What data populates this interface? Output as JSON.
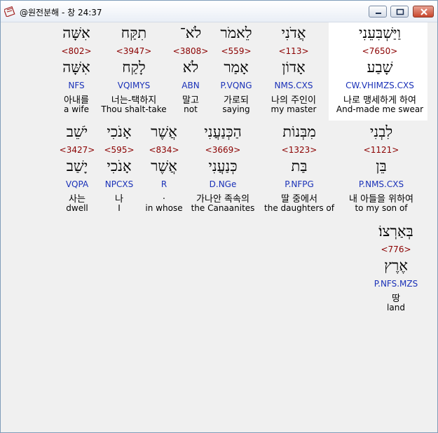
{
  "window": {
    "title": "@원전분해 - 창 24:37",
    "icon": "bible-app-icon",
    "accent": "#8b0000",
    "parse_color": "#1a31b8",
    "highlight_bg": "#ffffff"
  },
  "verse": {
    "line1": [
      {
        "heb": "וַיַּשְׁבִּעֵנִי",
        "num": "<7650>",
        "root": "שָׁבַע",
        "parse": "CW.VHIMZS.CXS",
        "kor": "나로 맹세하게 하여",
        "eng": "And-made me swear"
      },
      {
        "heb": "אֲדֹנִי",
        "num": "<113>",
        "root": "אָדוֹן",
        "parse": "NMS.CXS",
        "kor": "나의 주인이",
        "eng": "my master"
      },
      {
        "heb": "לֵאמֹר",
        "num": "<559>",
        "root": "אָמַר",
        "parse": "P.VQNG",
        "kor": "가로되",
        "eng": "saying"
      },
      {
        "heb": "לֹא־",
        "num": "<3808>",
        "root": "לֹא",
        "parse": "ABN",
        "kor": "말고",
        "eng": "not"
      },
      {
        "heb": "תִקַּח",
        "num": "<3947>",
        "root": "לָקַח",
        "parse": "VQIMYS",
        "kor": "너는-택하지",
        "eng": "Thou shalt-take"
      },
      {
        "heb": "אִשָּׁה",
        "num": "<802>",
        "root": "אִשָּׁה",
        "parse": "NFS",
        "kor": "아내를",
        "eng": "a wife"
      }
    ],
    "line2": [
      {
        "heb": "לִבְנִי",
        "num": "<1121>",
        "root": "בֵּן",
        "parse": "P.NMS.CXS",
        "kor": "내 아들을 위하여",
        "eng": "to my son of"
      },
      {
        "heb": "מִבְּנוֹת",
        "num": "<1323>",
        "root": "בַּת",
        "parse": "P.NFPG",
        "kor": "딸 중에서",
        "eng": "the daughters of"
      },
      {
        "heb": "הַכְּנַעֲנִי",
        "num": "<3669>",
        "root": "כְּנַעֲנִי",
        "parse": "D.NGe",
        "kor": "가나안 족속의",
        "eng": "the Canaanites"
      },
      {
        "heb": "אֲשֶׁר",
        "num": "<834>",
        "root": "אֲשֶׁר",
        "parse": "R",
        "kor": ".",
        "eng": "in whose"
      },
      {
        "heb": "אָנֹכִי",
        "num": "<595>",
        "root": "אָנֹכִי",
        "parse": "NPCXS",
        "kor": "나",
        "eng": "I"
      },
      {
        "heb": "יֹשֵׁב",
        "num": "<3427>",
        "root": "יָשַׁב",
        "parse": "VQPA",
        "kor": "사는",
        "eng": "dwell"
      }
    ],
    "line3": [
      {
        "heb": "בְּאַרְצוֹ׃",
        "num": "<776>",
        "root": "אֶרֶץ",
        "parse": "P.NFS.MZS",
        "kor": "땅",
        "eng": "land"
      }
    ]
  }
}
